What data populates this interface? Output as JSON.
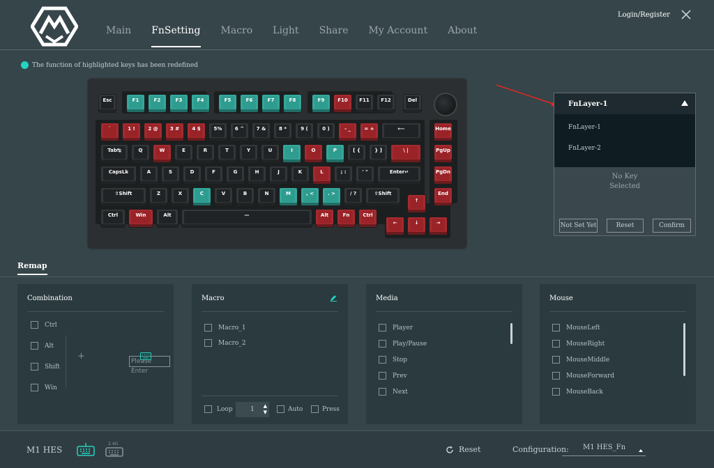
{
  "nav": [
    "Main",
    "FnSetting",
    "Macro",
    "Light",
    "Share",
    "My Account",
    "About"
  ],
  "login": "Login/Register",
  "notice": "The function of highlighted keys has been redefined",
  "fn_panel": {
    "selected": "FnLayer-1",
    "options": [
      "FnLayer-1",
      "FnLayer-2"
    ],
    "status_line1": "No Key",
    "status_line2": "Selected",
    "not_set": "Not Set Yet",
    "reset": "Reset",
    "confirm": "Confirm"
  },
  "remap_title": "Remap",
  "combination": {
    "title": "Combination",
    "items": [
      "Ctrl",
      "Alt",
      "Shift",
      "Win"
    ],
    "placeholder": "Please Enter"
  },
  "macro": {
    "title": "Macro",
    "items": [
      "Macro_1",
      "Macro_2"
    ],
    "loop": "Loop",
    "count": "1",
    "auto": "Auto",
    "press": "Press"
  },
  "media": {
    "title": "Media",
    "items": [
      "Player",
      "Play/Pause",
      "Stop",
      "Prev",
      "Next"
    ]
  },
  "mouse": {
    "title": "Mouse",
    "items": [
      "MouseLeft",
      "MouseRight",
      "MouseMiddle",
      "MouseForward",
      "MouseBack"
    ]
  },
  "footer": {
    "device": "M1 HES",
    "wireless": "2.4G",
    "reset": "Reset",
    "config_label": "Configuration:",
    "config_value": "M1 HES_Fn"
  },
  "keys": {
    "f": [
      "Esc",
      "F1",
      "F2",
      "F3",
      "F4",
      "F5",
      "F6",
      "F7",
      "F8",
      "F9",
      "F10",
      "F11",
      "F12",
      "Del"
    ],
    "n": [
      "`",
      "1 !",
      "2 @",
      "3 #",
      "4 $",
      "5%",
      "6 ^",
      "7 &",
      "8 *",
      "9 (",
      "0 )",
      "- _",
      "= +",
      "⟵",
      "Home"
    ],
    "q": [
      "Tab↹",
      "Q",
      "W",
      "E",
      "R",
      "T",
      "Y",
      "U",
      "I",
      "O",
      "P",
      "[ {",
      "} ]",
      "\\ |",
      "PgUp"
    ],
    "a": [
      "CapsLk",
      "A",
      "S",
      "D",
      "F",
      "G",
      "H",
      "J",
      "K",
      "L",
      "; :",
      "' \"",
      "Enter↵",
      "PgDn"
    ],
    "z": [
      "⇧Shift",
      "Z",
      "X",
      "C",
      "V",
      "B",
      "N",
      "M",
      ", <",
      ". >",
      "/ ?",
      "⇧Shift",
      "↑",
      "End"
    ],
    "b": [
      "Ctrl",
      "Win",
      "Alt",
      "—",
      "Alt",
      "Fn",
      "Ctrl",
      "←",
      "↓",
      "→"
    ]
  },
  "colors": {
    "accent": "#23d3c0",
    "teal": "#33a89b",
    "red": "#a52a2f"
  }
}
